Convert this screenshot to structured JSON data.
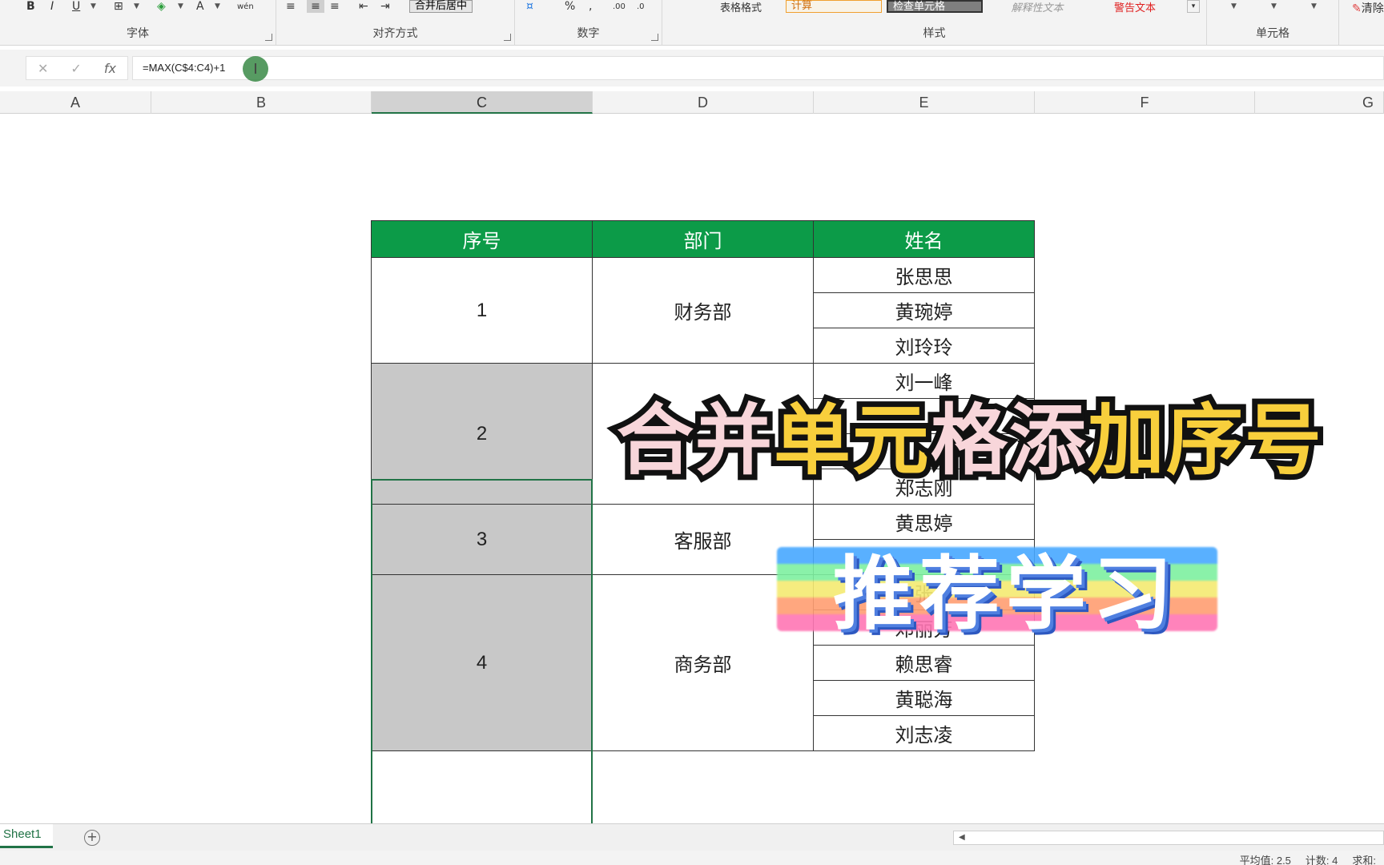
{
  "ribbon": {
    "groups": [
      {
        "label": "字体"
      },
      {
        "label": "对齐方式"
      },
      {
        "label": "数字"
      },
      {
        "label": "样式"
      },
      {
        "label": "单元格"
      }
    ],
    "font_buttons": {
      "bold": "B",
      "italic": "I",
      "underline": "U",
      "font_color": "A",
      "wen": "wén"
    },
    "merge_button": "合并后居中",
    "number_buttons": {
      "percent": "%",
      "comma": ","
    },
    "styles": {
      "table_format": "表格格式",
      "calc": "计算",
      "check_cell": "检查单元格",
      "explain_text": "解释性文本",
      "warning_text": "警告文本"
    },
    "clear_label": "清除"
  },
  "formula_bar": {
    "cancel": "✕",
    "enter": "✓",
    "fx": "fx",
    "formula": "=MAX(C$4:C4)+1"
  },
  "columns": [
    "A",
    "B",
    "C",
    "D",
    "E",
    "F",
    "G"
  ],
  "selected_column": "C",
  "table": {
    "headers": [
      "序号",
      "部门",
      "姓名"
    ],
    "groups": [
      {
        "seq": "1",
        "dept": "财务部",
        "names": [
          "张思思",
          "黄琬婷",
          "刘玲玲"
        ],
        "highlighted": false
      },
      {
        "seq": "2",
        "dept": "",
        "names": [
          "刘一峰",
          "",
          "",
          "郑志刚"
        ],
        "highlighted": true
      },
      {
        "seq": "3",
        "dept": "客服部",
        "names": [
          "黄思婷",
          ""
        ],
        "highlighted": true
      },
      {
        "seq": "4",
        "dept": "商务部",
        "names": [
          "张",
          "邓丽芳",
          "赖思睿",
          "黄聪海",
          "刘志凌"
        ],
        "highlighted": true
      }
    ]
  },
  "overlay": {
    "title_part1": "合并",
    "title_part2": "单元",
    "title_part3": "格添",
    "title_part4": "加序号",
    "promo": "推荐学习"
  },
  "bottom": {
    "sheet_tab": "Sheet1",
    "add_sheet": "+",
    "status": {
      "average": "平均值: 2.5",
      "count": "计数: 4",
      "sum": "求和:"
    }
  },
  "colors": {
    "accent": "#217346",
    "header_green": "#0c9b48",
    "selection_gray": "#c8c8c8"
  }
}
